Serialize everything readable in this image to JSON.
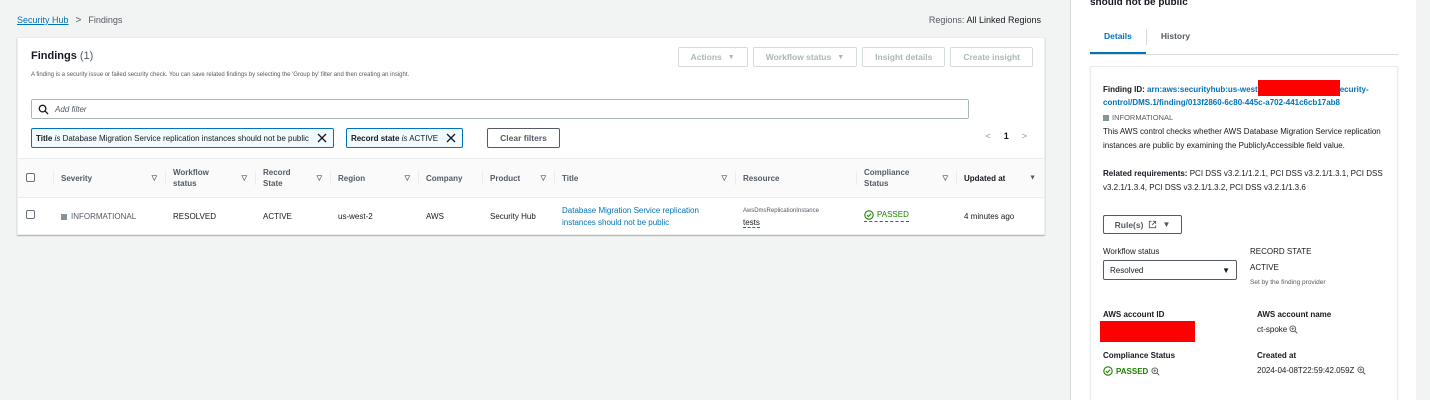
{
  "breadcrumb": {
    "root": "Security Hub",
    "separator": ">",
    "current": "Findings"
  },
  "regions": {
    "label": "Regions:",
    "value": "All Linked Regions"
  },
  "findings_panel": {
    "title": "Findings",
    "count": "(1)",
    "description": "A finding is a security issue or failed security check. You can save related findings by selecting the 'Group by' filter and then creating an insight.",
    "actions": [
      {
        "label": "Actions",
        "dropdown": true
      },
      {
        "label": "Workflow status",
        "dropdown": true
      },
      {
        "label": "Insight details",
        "dropdown": false
      },
      {
        "label": "Create insight",
        "dropdown": false
      }
    ],
    "filter_placeholder": "Add filter",
    "tokens": [
      {
        "key": "Title",
        "op": "is",
        "value": "Database Migration Service replication instances should not be public"
      },
      {
        "key": "Record state",
        "op": "is",
        "value": "ACTIVE"
      }
    ],
    "clear_filters": "Clear filters",
    "pagination": {
      "prev": "<",
      "page": "1",
      "next": ">"
    },
    "columns": [
      {
        "label": "Severity",
        "sort": "▽"
      },
      {
        "label": "Workflow status",
        "sort": "▽"
      },
      {
        "label": "Record State",
        "sort": "▽"
      },
      {
        "label": "Region",
        "sort": "▽"
      },
      {
        "label": "Company",
        "sort": ""
      },
      {
        "label": "Product",
        "sort": "▽"
      },
      {
        "label": "Title",
        "sort": "▽"
      },
      {
        "label": "Resource",
        "sort": ""
      },
      {
        "label": "Compliance Status",
        "sort": "▽"
      },
      {
        "label": "Updated at",
        "sort": "▼"
      }
    ],
    "rows": [
      {
        "severity": "INFORMATIONAL",
        "workflow_status": "RESOLVED",
        "record_state": "ACTIVE",
        "region": "us-west-2",
        "company": "AWS",
        "product": "Security Hub",
        "title": "Database Migration Service replication instances should not be public",
        "resource_type": "AwsDmsReplicationInstance",
        "resource_value": "tests",
        "compliance": "PASSED",
        "updated": "4 minutes ago"
      }
    ]
  },
  "side_panel": {
    "title": "should not be public",
    "tabs": [
      "Details",
      "History"
    ],
    "finding_id_label": "Finding ID:",
    "finding_id_start": "arn:aws:securityhub:us-west",
    "finding_id_end": "ecurity-control/DMS.1/finding/013f2860-6c80-445c-a702-441c6cb17ab8",
    "severity": "INFORMATIONAL",
    "description": "This AWS control checks whether AWS Database Migration Service replication instances are public by examining the PubliclyAccessible field value.",
    "requirements_label": "Related requirements:",
    "requirements": "PCI DSS v3.2.1/1.2.1, PCI DSS v3.2.1/1.3.1, PCI DSS v3.2.1/1.3.4, PCI DSS v3.2.1/1.3.2, PCI DSS v3.2.1/1.3.6",
    "rules_button": "Rule(s)",
    "workflow_status_label": "Workflow status",
    "workflow_status_value": "Resolved",
    "record_state_label": "RECORD STATE",
    "record_state_value": "ACTIVE",
    "record_state_note": "Set by the finding provider",
    "account_id_label": "AWS account ID",
    "account_name_label": "AWS account name",
    "account_name_value": "ct-spoke",
    "compliance_label": "Compliance Status",
    "compliance_value": "PASSED",
    "created_label": "Created at",
    "created_value": "2024-04-08T22:59:42.059Z"
  },
  "colors": {
    "link": "#0073bb",
    "passed": "#1d8102",
    "redaction": "#ff0000"
  }
}
